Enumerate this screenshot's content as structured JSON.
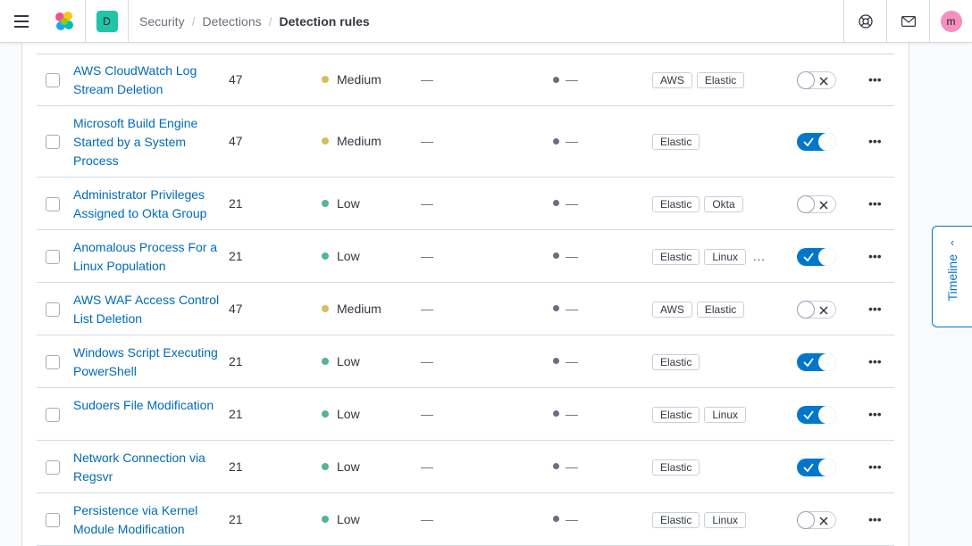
{
  "header": {
    "space_initial": "D",
    "user_initial": "m",
    "breadcrumbs": [
      "Security",
      "Detections",
      "Detection rules"
    ]
  },
  "colors": {
    "medium": "#d6bf57",
    "low": "#54b399",
    "link": "#006bb8",
    "toggle_on": "#0077cc"
  },
  "rules": [
    {
      "name": "AWS CloudWatch Log Stream Deletion",
      "score": "47",
      "severity": "Medium",
      "last_run": "—",
      "status": "—",
      "tags": [
        "AWS",
        "Elastic"
      ],
      "more_tags": false,
      "enabled": false
    },
    {
      "name": "Microsoft Build Engine Started by a System Process",
      "score": "47",
      "severity": "Medium",
      "last_run": "—",
      "status": "—",
      "tags": [
        "Elastic"
      ],
      "more_tags": false,
      "enabled": true
    },
    {
      "name": "Administrator Privileges Assigned to Okta Group",
      "score": "21",
      "severity": "Low",
      "last_run": "—",
      "status": "—",
      "tags": [
        "Elastic",
        "Okta"
      ],
      "more_tags": false,
      "enabled": false
    },
    {
      "name": "Anomalous Process For a Linux Population",
      "score": "21",
      "severity": "Low",
      "last_run": "—",
      "status": "—",
      "tags": [
        "Elastic",
        "Linux"
      ],
      "more_tags": true,
      "enabled": true
    },
    {
      "name": "AWS WAF Access Control List Deletion",
      "score": "47",
      "severity": "Medium",
      "last_run": "—",
      "status": "—",
      "tags": [
        "AWS",
        "Elastic"
      ],
      "more_tags": false,
      "enabled": false
    },
    {
      "name": "Windows Script Executing PowerShell",
      "score": "21",
      "severity": "Low",
      "last_run": "—",
      "status": "—",
      "tags": [
        "Elastic"
      ],
      "more_tags": false,
      "enabled": true
    },
    {
      "name": "Sudoers File Modification",
      "score": "21",
      "severity": "Low",
      "last_run": "—",
      "status": "—",
      "tags": [
        "Elastic",
        "Linux"
      ],
      "more_tags": false,
      "enabled": true
    },
    {
      "name": "Network Connection via Regsvr",
      "score": "21",
      "severity": "Low",
      "last_run": "—",
      "status": "—",
      "tags": [
        "Elastic"
      ],
      "more_tags": false,
      "enabled": true
    },
    {
      "name": "Persistence via Kernel Module Modification",
      "score": "21",
      "severity": "Low",
      "last_run": "—",
      "status": "—",
      "tags": [
        "Elastic",
        "Linux"
      ],
      "more_tags": false,
      "enabled": false
    }
  ],
  "more_tags_label": "...",
  "actions_label": "•••",
  "timeline": {
    "label": "Timeline"
  }
}
